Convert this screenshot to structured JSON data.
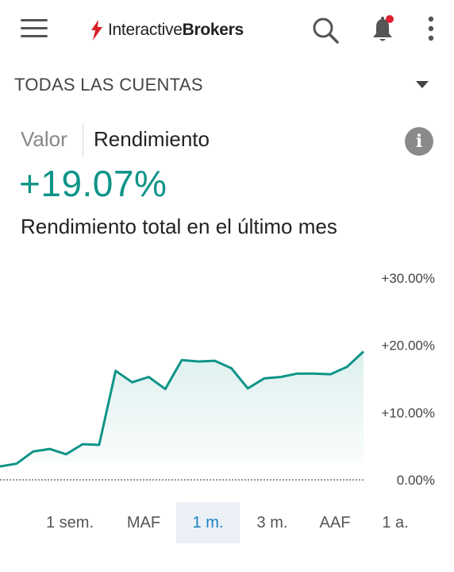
{
  "header": {
    "brand_regular_1": "Interactive",
    "brand_bold": "Brokers",
    "icons": [
      "menu-icon",
      "search-icon",
      "bell-icon",
      "more-vertical-icon"
    ],
    "notification_dot_color": "#e0202e"
  },
  "account": {
    "label": "TODAS LAS CUENTAS"
  },
  "tabs": {
    "valor": "Valor",
    "rendimiento": "Rendimiento",
    "active": "Rendimiento"
  },
  "summary": {
    "return_value": "+19.07%",
    "description": "Rendimiento total en el último mes"
  },
  "colors": {
    "accent": "#0f9488",
    "active_range_bg": "#eaf0f5",
    "active_range_text": "#1a7fc0"
  },
  "chart_data": {
    "type": "area",
    "y_tick_labels": [
      "+30.00%",
      "+20.00%",
      "+10.00%",
      "0.00%"
    ],
    "ylim": [
      0,
      30
    ],
    "y_axis_side": "right",
    "series": [
      {
        "values": [
          2.0,
          2.4,
          4.2,
          4.6,
          3.8,
          5.3,
          5.2,
          16.2,
          14.5,
          15.3,
          13.5,
          17.8,
          17.6,
          17.7,
          16.6,
          13.6,
          15.1,
          15.3,
          15.8,
          15.8,
          15.7,
          16.8,
          19.07
        ]
      }
    ],
    "baseline_style": "dotted"
  },
  "ranges": [
    "1 sem.",
    "MAF",
    "1 m.",
    "3 m.",
    "AAF",
    "1 a."
  ],
  "active_range": "1 m."
}
